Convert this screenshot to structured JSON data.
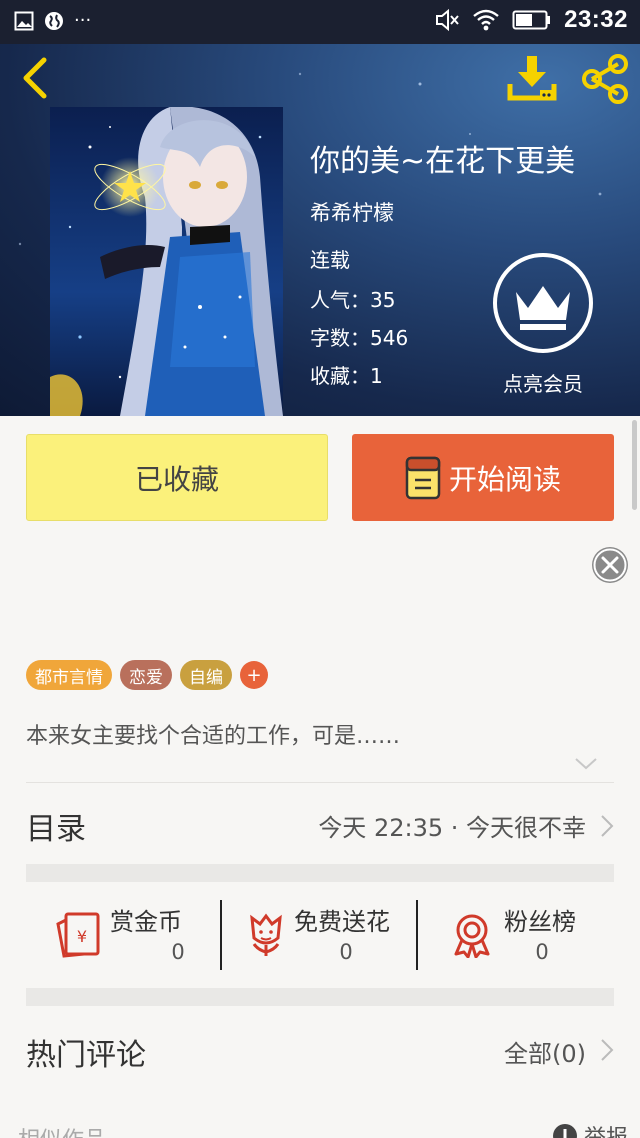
{
  "status_bar": {
    "time": "23:32",
    "left_icons": [
      "image-icon",
      "globe-icon",
      "more-dots-icon"
    ],
    "right_icons": [
      "mute-icon",
      "wifi-icon",
      "battery-icon"
    ],
    "dots": "···"
  },
  "header": {
    "back_icon": "chevron-left-icon",
    "download_icon": "download-icon",
    "share_icon": "share-icon",
    "accent_color": "#f5d200"
  },
  "book": {
    "title": "你的美~在花下更美",
    "author": "希希柠檬",
    "status": "连载",
    "popularity": "人气：35",
    "word_count": "字数：546",
    "favorites": "收藏：1"
  },
  "vip": {
    "label": "点亮会员",
    "icon": "crown-icon"
  },
  "actions": {
    "favorited_label": "已收藏",
    "read_label": "开始阅读",
    "favorited_color": "#fbf17b",
    "read_color": "#e8633a"
  },
  "tags": [
    {
      "label": "都市言情",
      "color": "#f0a63a"
    },
    {
      "label": "恋爱",
      "color": "#b9705c"
    },
    {
      "label": "自编",
      "color": "#c9a03f"
    }
  ],
  "tag_add": "+",
  "summary": "本来女主要找个合适的工作，可是……",
  "toc": {
    "title": "目录",
    "latest": "今天 22:35 · 今天很不幸"
  },
  "stats": [
    {
      "label": "赏金币",
      "value": "0",
      "icon": "red-envelope-icon"
    },
    {
      "label": "免费送花",
      "value": "0",
      "icon": "flower-icon"
    },
    {
      "label": "粉丝榜",
      "value": "0",
      "icon": "badge-icon"
    }
  ],
  "comments": {
    "title": "热门评论",
    "all_label": "全部(0)"
  },
  "footer": {
    "similar": "相似作品",
    "report": "举报"
  }
}
